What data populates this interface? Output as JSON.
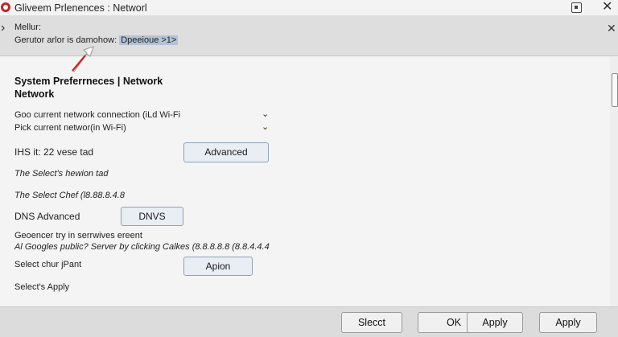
{
  "window": {
    "title": "Gliveem Prlenences  : Networl",
    "close": "✕"
  },
  "infobar": {
    "title": "Mellur:",
    "text": "Gerutor  arlor  is  damohow: ",
    "link": "Dpeeioue >1>",
    "close": "✕",
    "expand": "›"
  },
  "main": {
    "heading": "System Preferrneces  |  Network",
    "subheading": "Network",
    "dropdown1": {
      "label": "Goo current network connection (iLd Wi-Fi",
      "chevron": "⌄"
    },
    "dropdown2": {
      "label": "Pick current networ(in Wi-Fi)",
      "chevron": "⌄"
    },
    "ihs_label": "IHS  it: 22  vese tad",
    "advanced_button": "Advanced",
    "select_hewion": "The Select's hewion tad",
    "select_chef": "The Select Chef (l8.88.8.4.8",
    "dns_label": "DNS Advanced",
    "dnvs_button": "DNVS",
    "geoencer": "Geoencer try  in serrwives ereent",
    "google": "Al Googles public? Server by clicking Calkes (8.8.8.8.8  (8.8.4.4.4",
    "select_chur": "Select chur jPant",
    "apion_button": "Apion",
    "selects_apply": "Select's Apply"
  },
  "footer": {
    "buttons": [
      "Slecct",
      "OK",
      "Apply",
      "Apply"
    ]
  },
  "colors": {
    "accent_button_bg": "#e9edf4",
    "accent_button_border": "#8fa2b9",
    "infobar_bg": "#dedede",
    "link_highlight": "#b3c3d6",
    "app_icon": "#c4242b"
  },
  "icons": {
    "app": "app-logo-icon",
    "restore": "restore-window-icon",
    "cursor": "pointer-cursor-icon"
  }
}
